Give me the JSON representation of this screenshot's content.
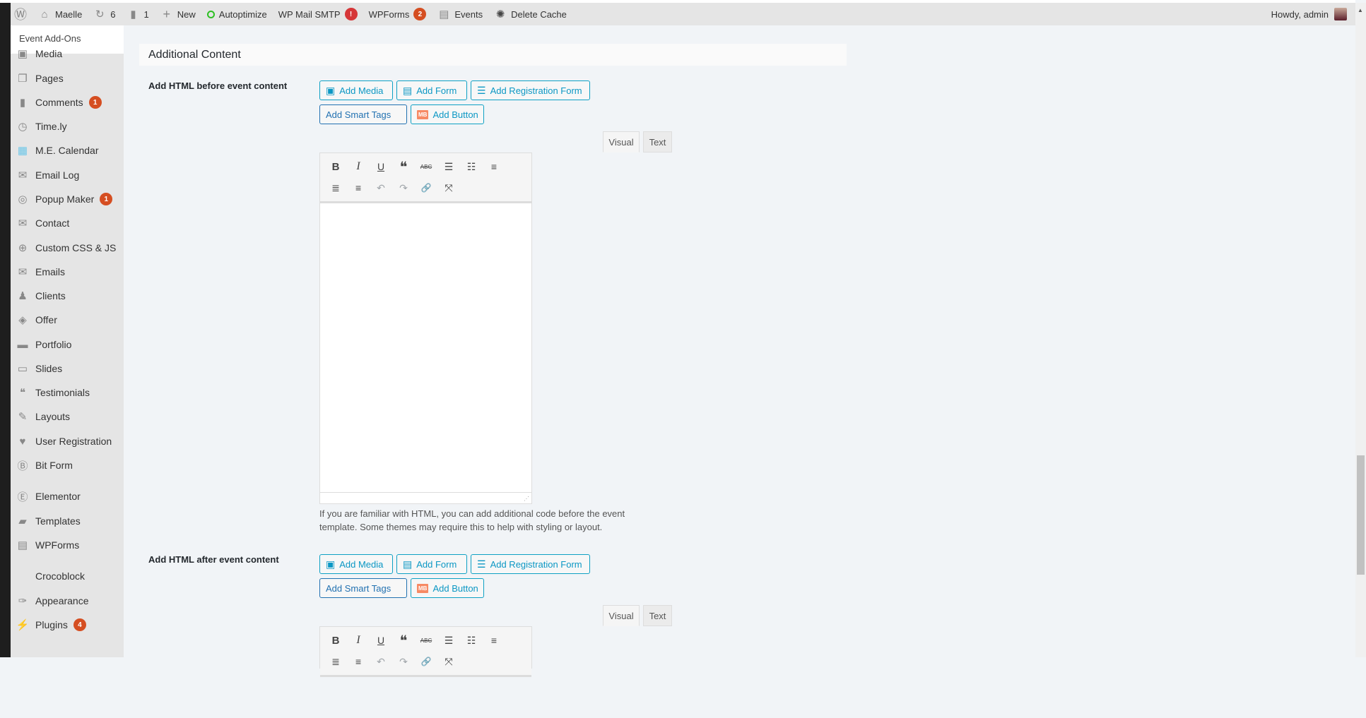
{
  "adminbar": {
    "site": "Maelle",
    "updates": "6",
    "comments": "1",
    "new": "New",
    "autoptimize": "Autoptimize",
    "smtp": "WP Mail SMTP",
    "smtp_badge": "!",
    "wpforms": "WPForms",
    "wpforms_badge": "2",
    "events": "Events",
    "delete_cache": "Delete Cache",
    "howdy": "Howdy, admin"
  },
  "sidebar": {
    "current": "Event Add-Ons",
    "items": [
      {
        "label": "Media",
        "icon": "media-icon"
      },
      {
        "label": "Pages",
        "icon": "pages-icon"
      },
      {
        "label": "Comments",
        "icon": "comments-icon",
        "badge": "1"
      },
      {
        "label": "Time.ly",
        "icon": "timely-icon"
      },
      {
        "label": "M.E. Calendar",
        "icon": "calendar-icon"
      },
      {
        "label": "Email Log",
        "icon": "email-icon"
      },
      {
        "label": "Popup Maker",
        "icon": "popup-icon",
        "badge": "1"
      },
      {
        "label": "Contact",
        "icon": "envelope-icon"
      },
      {
        "label": "Custom CSS & JS",
        "icon": "plus-circle-icon"
      },
      {
        "label": "Emails",
        "icon": "envelope-icon"
      },
      {
        "label": "Clients",
        "icon": "user-icon"
      },
      {
        "label": "Offer",
        "icon": "tag-icon"
      },
      {
        "label": "Portfolio",
        "icon": "folder-icon"
      },
      {
        "label": "Slides",
        "icon": "slides-icon"
      },
      {
        "label": "Testimonials",
        "icon": "quote-icon"
      },
      {
        "label": "Layouts",
        "icon": "pencil-icon"
      },
      {
        "label": "User Registration",
        "icon": "user-registration-icon"
      },
      {
        "label": "Bit Form",
        "icon": "bit-form-icon"
      },
      {
        "label": "Elementor",
        "icon": "elementor-icon"
      },
      {
        "label": "Templates",
        "icon": "folder-open-icon"
      },
      {
        "label": "WPForms",
        "icon": "wpforms-icon"
      },
      {
        "label": "Crocoblock",
        "icon": ""
      },
      {
        "label": "Appearance",
        "icon": "brush-icon"
      },
      {
        "label": "Plugins",
        "icon": "plugin-icon",
        "badge": "4"
      }
    ]
  },
  "main": {
    "section_title": "Additional Content",
    "buttons": {
      "add_media": "Add Media",
      "add_form": "Add Form",
      "add_registration_form": "Add Registration Form",
      "add_smart_tags": "Add Smart Tags",
      "add_button": "Add Button",
      "mb_logo": "MB"
    },
    "tabs": {
      "visual": "Visual",
      "text": "Text"
    },
    "before": {
      "label": "Add HTML before event content",
      "help": "If you are familiar with HTML, you can add additional code before the event template. Some themes may require this to help with styling or layout."
    },
    "after": {
      "label": "Add HTML after event content"
    }
  },
  "colors": {
    "accent": "#0b97c4",
    "badge": "#d54e21",
    "sidebar": "#e5e5e5"
  }
}
